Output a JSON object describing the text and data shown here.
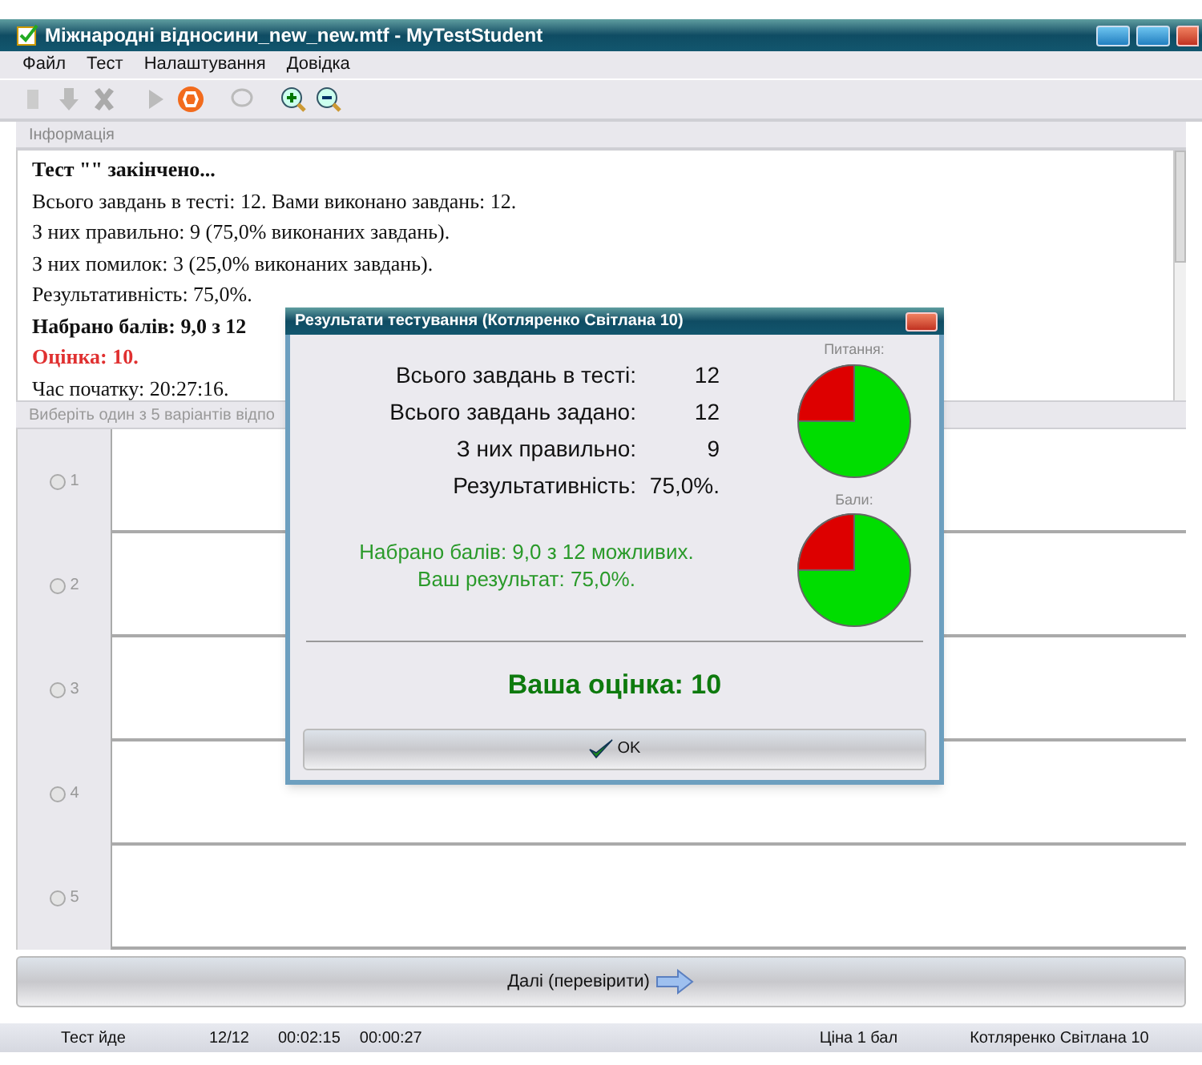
{
  "window": {
    "title": "Міжнародні відносини_new_new.mtf - MyTestStudent"
  },
  "menu": [
    "Файл",
    "Тест",
    "Налаштування",
    "Довідка"
  ],
  "info_panel": {
    "header": "Інформація",
    "lines": [
      {
        "kind": "title",
        "text": "Тест \"\" закінчено..."
      },
      {
        "kind": "normal",
        "text": "Всього завдань в тесті: 12. Вами виконано завдань: 12."
      },
      {
        "kind": "normal",
        "text": "З них правильно: 9 (75,0% виконаних завдань)."
      },
      {
        "kind": "normal",
        "text": "З них помилок: 3 (25,0% виконаних завдань)."
      },
      {
        "kind": "normal",
        "text": "Результативність: 75,0%."
      },
      {
        "kind": "bold",
        "text": "Набрано балів: 9,0 з 12"
      },
      {
        "kind": "grade",
        "text": "Оцінка: 10."
      },
      {
        "kind": "normal",
        "text": "Час початку: 20:27:16."
      }
    ]
  },
  "answers_panel": {
    "header": "Виберіть один з 5 варіантів відпо",
    "options": [
      {
        "label": "1",
        "selected": false
      },
      {
        "label": "2",
        "selected": false
      },
      {
        "label": "3",
        "selected": false
      },
      {
        "label": "4",
        "selected": false
      },
      {
        "label": "5",
        "selected": false
      }
    ]
  },
  "next_button": "Далі (перевірити)",
  "status_bar": [
    "Тест йде",
    "12/12",
    "00:02:15",
    "00:00:27",
    "Ціна 1 бал",
    "Котляренко Світлана 10"
  ],
  "dialog": {
    "title": "Результати тестування (Котляренко Світлана 10)",
    "stats": [
      {
        "label": "Всього завдань в тесті:",
        "value": "12"
      },
      {
        "label": "Всього завдань задано:",
        "value": "12"
      },
      {
        "label": "З них правильно:",
        "value": "9"
      },
      {
        "label": "Результативність:",
        "value": "75,0%."
      }
    ],
    "chart_labels": [
      "Питання:",
      "Бали:"
    ],
    "score_lines": [
      "Набрано балів: 9,0 з 12 можливих.",
      "Ваш результат: 75,0%."
    ],
    "grade": "Ваша оцінка: 10",
    "ok_button": "OK"
  }
}
